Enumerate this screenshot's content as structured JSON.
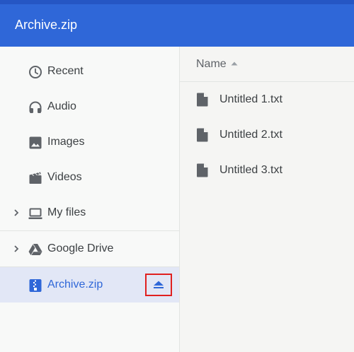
{
  "window": {
    "title": "Archive.zip"
  },
  "sidebar": {
    "items": [
      {
        "label": "Recent",
        "icon": "clock-icon"
      },
      {
        "label": "Audio",
        "icon": "headphones-icon"
      },
      {
        "label": "Images",
        "icon": "image-icon"
      },
      {
        "label": "Videos",
        "icon": "film-icon"
      },
      {
        "label": "My files",
        "icon": "laptop-icon",
        "expandable": true
      },
      {
        "label": "Google Drive",
        "icon": "google-drive-icon",
        "expandable": true
      },
      {
        "label": "Archive.zip",
        "icon": "zip-icon",
        "selected": true,
        "action_icon": "eject-icon"
      }
    ]
  },
  "file_list": {
    "column_header": "Name",
    "sort": "ascending",
    "files": [
      {
        "name": "Untitled 1.txt",
        "icon": "file-icon"
      },
      {
        "name": "Untitled 2.txt",
        "icon": "file-icon"
      },
      {
        "name": "Untitled 3.txt",
        "icon": "file-icon"
      }
    ]
  },
  "colors": {
    "titlebar": "#2f67d8",
    "accent": "#2f67d8",
    "selected_bg": "#e2e7f6",
    "highlight_box": "#e0201f"
  }
}
